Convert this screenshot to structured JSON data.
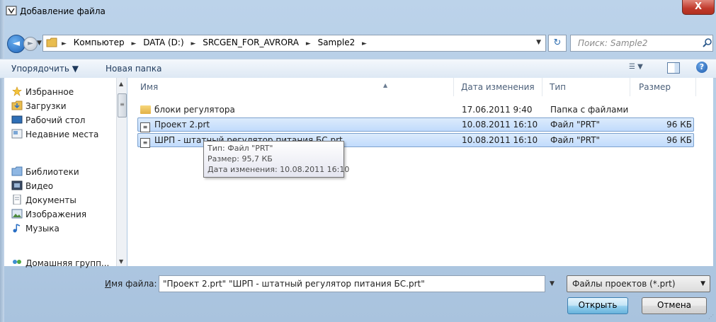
{
  "window": {
    "title": "Добавление файла",
    "close_label": "X"
  },
  "nav": {
    "back_label": "◄",
    "forward_label": "►",
    "breadcrumbs": [
      "Компьютер",
      "DATA (D:)",
      "SRCGEN_FOR_AVRORA",
      "Sample2"
    ],
    "search_placeholder": "Поиск: Sample2"
  },
  "toolbar": {
    "organize_label": "Упорядочить ▼",
    "new_folder_label": "Новая папка",
    "help_label": "?"
  },
  "sidebar": {
    "items": [
      {
        "label": "Избранное",
        "icon": "star-icon"
      },
      {
        "label": "Загрузки",
        "icon": "downloads-folder-icon"
      },
      {
        "label": "Рабочий стол",
        "icon": "desktop-icon"
      },
      {
        "label": "Недавние места",
        "icon": "recent-places-icon"
      },
      {
        "label": "Библиотеки",
        "icon": "libraries-icon"
      },
      {
        "label": "Видео",
        "icon": "video-icon"
      },
      {
        "label": "Документы",
        "icon": "documents-icon"
      },
      {
        "label": "Изображения",
        "icon": "images-icon"
      },
      {
        "label": "Музыка",
        "icon": "music-icon"
      },
      {
        "label": "Домашняя групп...",
        "icon": "homegroup-icon"
      }
    ]
  },
  "files": {
    "columns": {
      "name": "Имя",
      "date": "Дата изменения",
      "type": "Тип",
      "size": "Размер"
    },
    "rows": [
      {
        "name": "блоки регулятора",
        "date": "17.06.2011 9:40",
        "type": "Папка с файлами",
        "size": ""
      },
      {
        "name": "Проект 2.prt",
        "date": "10.08.2011 16:10",
        "type": "Файл \"PRT\"",
        "size": "96 КБ"
      },
      {
        "name": "ШРП - штатный регулятор питания БС.prt",
        "date": "10.08.2011 16:10",
        "type": "Файл \"PRT\"",
        "size": "96 КБ"
      }
    ]
  },
  "tooltip": {
    "line1": "Тип: Файл \"PRT\"",
    "line2": "Размер: 95,7 КБ",
    "line3": "Дата изменения: 10.08.2011 16:10"
  },
  "footer": {
    "filename_label_first": "И",
    "filename_label_rest": "мя файла:",
    "filename_value": "\"Проект 2.prt\" \"ШРП - штатный регулятор питания БС.prt\"",
    "filetype_value": "Файлы проектов (*.prt)",
    "open_label": "Открыть",
    "cancel_label": "Отмена"
  }
}
